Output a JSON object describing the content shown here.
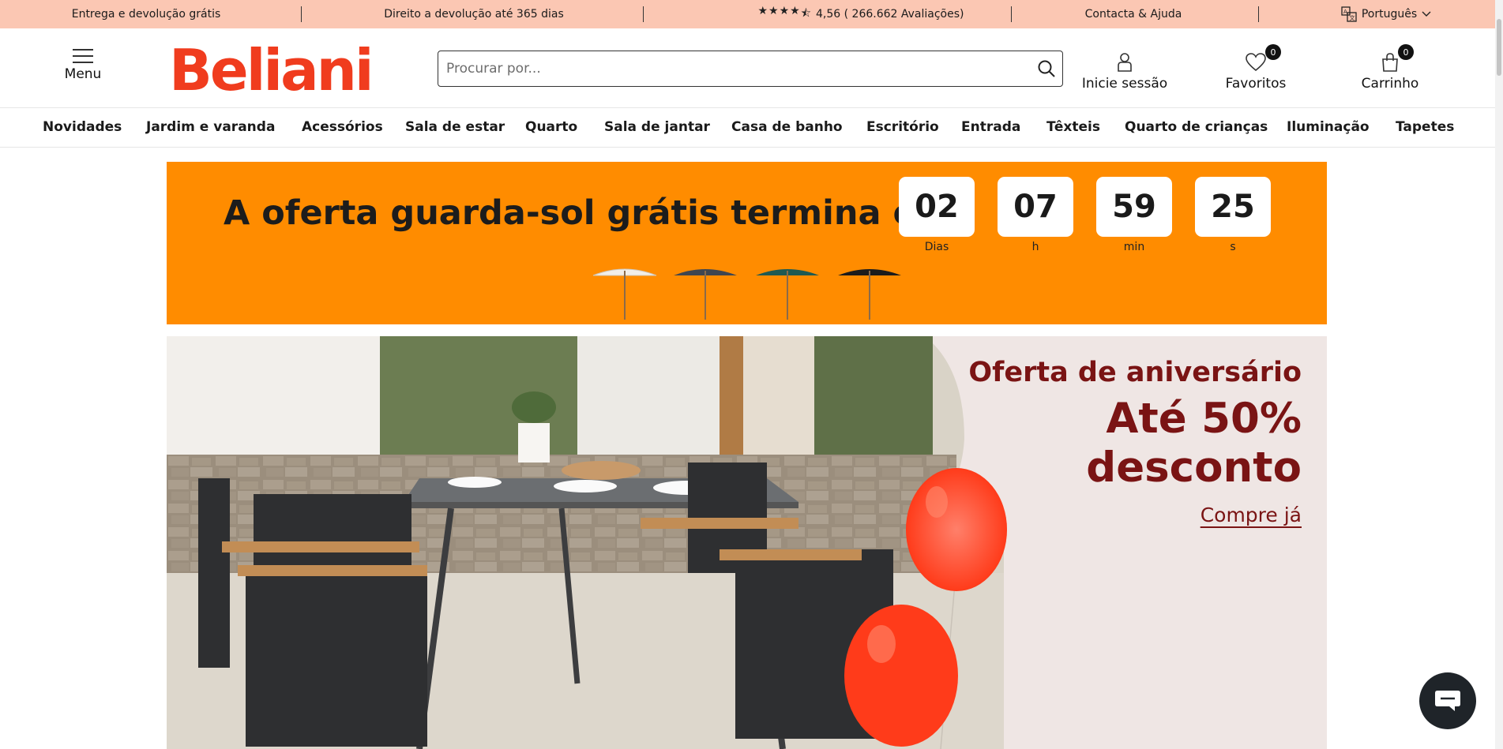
{
  "topbar": {
    "free_delivery": "Entrega e devolução grátis",
    "return_policy": "Direito a devolução até 365 dias",
    "rating": "4,56 ( 266.662 Avaliações)",
    "contact": "Contacta & Ajuda",
    "language": "Português",
    "stars_value": 4.5,
    "icons": [
      "star-icon",
      "translate-icon",
      "chevron-down-icon"
    ]
  },
  "header": {
    "menu_label": "Menu",
    "logo_text": "Beliani",
    "search_placeholder": "Procurar por...",
    "login_label": "Inicie sessão",
    "favorites_label": "Favoritos",
    "favorites_count": "0",
    "cart_label": "Carrinho",
    "cart_count": "0"
  },
  "nav": {
    "items": [
      "Novidades",
      "Jardim e varanda",
      "Acessórios",
      "Sala de estar",
      "Quarto",
      "Sala de jantar",
      "Casa de banho",
      "Escritório",
      "Entrada",
      "Têxteis",
      "Quarto de crianças",
      "Iluminação",
      "Tapetes"
    ]
  },
  "promo": {
    "headline": "A oferta guarda-sol grátis termina em:",
    "countdown": [
      {
        "value": "02",
        "unit": "Dias"
      },
      {
        "value": "07",
        "unit": "h"
      },
      {
        "value": "59",
        "unit": "min"
      },
      {
        "value": "25",
        "unit": "s"
      }
    ],
    "umbrella_colors": [
      "#f2eee8",
      "#3f4650",
      "#1f5a52",
      "#1c1c1c"
    ]
  },
  "hero": {
    "line1": "Oferta de aniversário",
    "line2": "Até 50%",
    "line3": "desconto",
    "cta": "Compre já"
  },
  "colors": {
    "topbar_bg": "#fbc7b3",
    "brand_red": "#f03c1e",
    "promo_orange": "#ff8c00",
    "hero_text": "#7a1414",
    "balloon": "#ff3b1a"
  }
}
